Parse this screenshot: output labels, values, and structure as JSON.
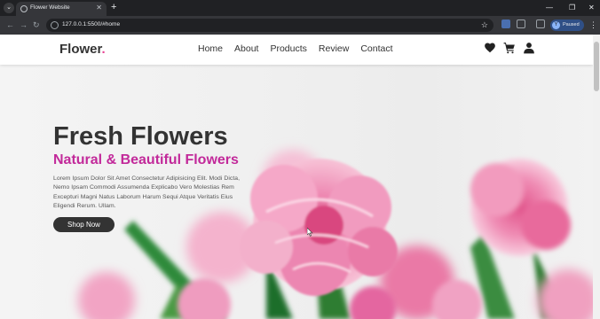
{
  "browser": {
    "tab_title": "Flower Website",
    "url": "127.0.0.1:5500/#home",
    "profile_initial": "Y",
    "profile_label": "Paused"
  },
  "site": {
    "logo_text": "Flower",
    "logo_dot": ".",
    "nav": [
      "Home",
      "About",
      "Products",
      "Review",
      "Contact"
    ],
    "header_icons": [
      "heart-icon",
      "cart-icon",
      "user-icon"
    ]
  },
  "hero": {
    "title": "Fresh Flowers",
    "subtitle": "Natural & Beautiful Flowers",
    "description": "Lorem Ipsum Dolor Sit Amet Consectetur Adipisicing Elit. Modi Dicta, Nemo Ipsam Commodi Assumenda Explicabo Vero Molestias Rem Excepturi Magni Natus Laborum Harum Sequi Atque Veritatis Eius Eligendi Rerum. Ullam.",
    "button_label": "Shop Now"
  },
  "colors": {
    "accent": "#e84393",
    "subtitle": "#c2299a",
    "text": "#333333",
    "button_bg": "#333333"
  }
}
